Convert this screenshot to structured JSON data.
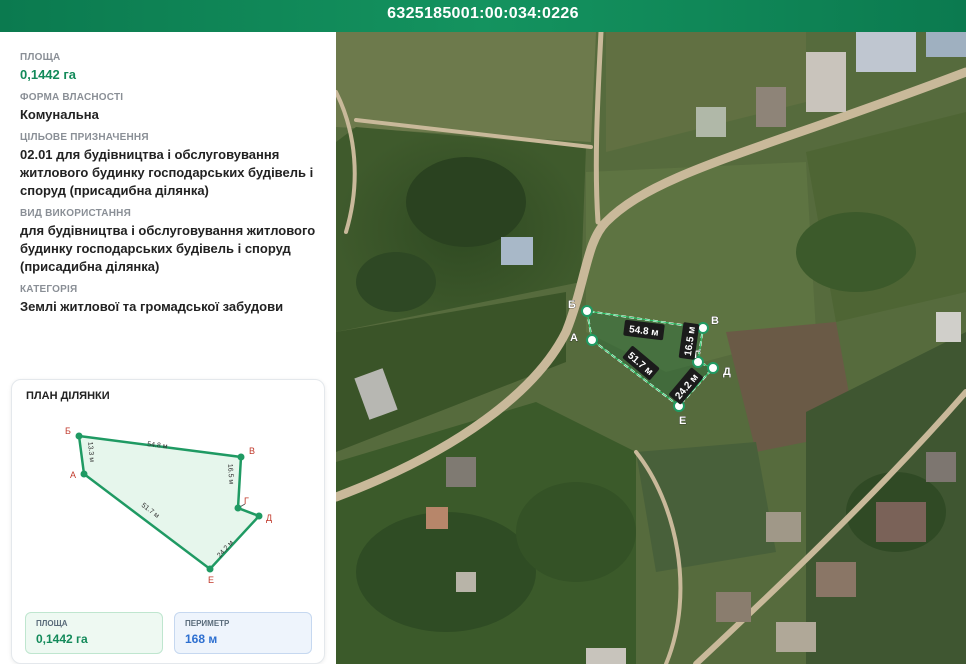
{
  "header": {
    "cadastral_number": "6325185001:00:034:0226"
  },
  "info": {
    "area_label": "ПЛОЩА",
    "area_value": "0,1442 га",
    "ownership_label": "ФОРМА ВЛАСНОСТІ",
    "ownership_value": "Комунальна",
    "purpose_label": "ЦІЛЬОВЕ ПРИЗНАЧЕННЯ",
    "purpose_value": "02.01 для будівництва і обслуговування житлового будинку господарських будівель і споруд (присадибна ділянка)",
    "usage_label": "ВИД ВИКОРИСТАННЯ",
    "usage_value": "для будівництва і обслуговування житлового будинку господарських будівель і споруд (присадибна ділянка)",
    "category_label": "КАТЕГОРІЯ",
    "category_value": "Землі житлової та громадської забудови"
  },
  "plan": {
    "title": "ПЛАН ДІЛЯНКИ",
    "vertices": [
      "А",
      "Б",
      "В",
      "Г",
      "Д",
      "Е"
    ],
    "sides": {
      "ab": "13.3 м",
      "bv": "54.8 м",
      "vg": "16.5 м",
      "gd": "",
      "de": "24.2 м",
      "ea": "51.7 м"
    },
    "area_label": "ПЛОЩА",
    "area_value": "0,1442 га",
    "perimeter_label": "ПЕРИМЕТР",
    "perimeter_value": "168 м"
  },
  "map": {
    "vertices": [
      "А",
      "Б",
      "В",
      "Г",
      "Д",
      "Е"
    ],
    "sides": {
      "bv": "54.8 м",
      "vg": "16.5 м",
      "ea": "51.7 м",
      "de": "24.2 м"
    }
  },
  "colors": {
    "header": "#0b7a4f",
    "accent_green": "#138a5a",
    "accent_blue": "#2d6fd0",
    "vertex_label": "#c0392b"
  }
}
